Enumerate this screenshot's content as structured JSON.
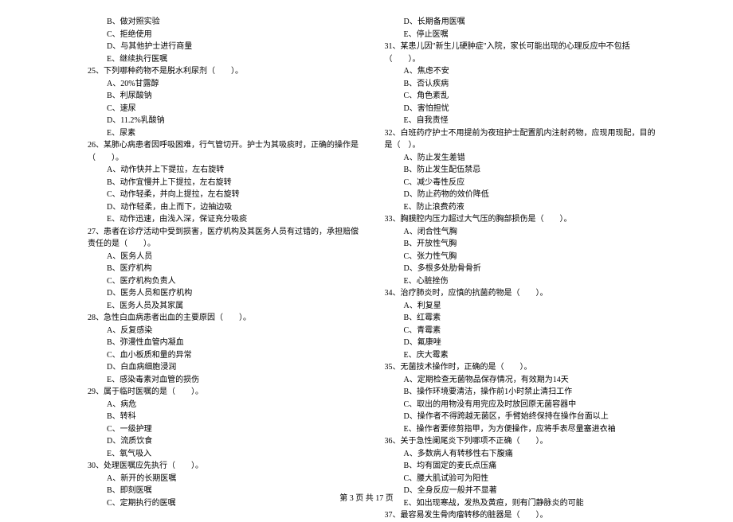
{
  "leftColumn": [
    {
      "cls": "option",
      "text": "B、做对照实验"
    },
    {
      "cls": "option",
      "text": "C、拒绝使用"
    },
    {
      "cls": "option",
      "text": "D、与其他护士进行商量"
    },
    {
      "cls": "option",
      "text": "E、继续执行医嘱"
    },
    {
      "cls": "question",
      "text": "25、下列哪种药物不是脱水利尿剂（　　）。"
    },
    {
      "cls": "option",
      "text": "A、20%甘露醇"
    },
    {
      "cls": "option",
      "text": "B、利尿酸钠"
    },
    {
      "cls": "option",
      "text": "C、速尿"
    },
    {
      "cls": "option",
      "text": "D、11.2%乳酸钠"
    },
    {
      "cls": "option",
      "text": "E、尿素"
    },
    {
      "cls": "question",
      "text": "26、某肺心病患者因呼吸困难，行气管切开。护士为其吸痰时，正确的操作是（　　）。"
    },
    {
      "cls": "option",
      "text": "A、动作快并上下提拉，左右旋转"
    },
    {
      "cls": "option",
      "text": "B、动作宜慢并上下提拉，左右旋转"
    },
    {
      "cls": "option",
      "text": "C、动作轻柔，并向上提拉，左右旋转"
    },
    {
      "cls": "option",
      "text": "D、动作轻柔，由上而下，边抽边吸"
    },
    {
      "cls": "option",
      "text": "E、动作迅速，由浅入深，保证充分吸痰"
    },
    {
      "cls": "question",
      "text": "27、患者在诊疗活动中受到损害，医疗机构及其医务人员有过错的，承担赔偿责任的是（　　）。"
    },
    {
      "cls": "option",
      "text": "A、医务人员"
    },
    {
      "cls": "option",
      "text": "B、医疗机构"
    },
    {
      "cls": "option",
      "text": "C、医疗机构负责人"
    },
    {
      "cls": "option",
      "text": "D、医务人员和医疗机构"
    },
    {
      "cls": "option",
      "text": "E、医务人员及其家属"
    },
    {
      "cls": "question",
      "text": "28、急性白血病患者出血的主要原因（　　）。"
    },
    {
      "cls": "option",
      "text": "A、反复感染"
    },
    {
      "cls": "option",
      "text": "B、弥漫性血管内凝血"
    },
    {
      "cls": "option",
      "text": "C、血小板质和量的异常"
    },
    {
      "cls": "option",
      "text": "D、白血病细胞浸润"
    },
    {
      "cls": "option",
      "text": "E、感染毒素对血管的损伤"
    },
    {
      "cls": "question",
      "text": "29、属于临时医嘱的是（　　）。"
    },
    {
      "cls": "option",
      "text": "A、病危"
    },
    {
      "cls": "option",
      "text": "B、转科"
    },
    {
      "cls": "option",
      "text": "C、一级护理"
    },
    {
      "cls": "option",
      "text": "D、流质饮食"
    },
    {
      "cls": "option",
      "text": "E、氧气吸入"
    },
    {
      "cls": "question",
      "text": "30、处理医嘱应先执行（　　）。"
    },
    {
      "cls": "option",
      "text": "A、新开的长期医嘱"
    },
    {
      "cls": "option",
      "text": "B、即刻医嘱"
    },
    {
      "cls": "option",
      "text": "C、定期执行的医嘱"
    }
  ],
  "rightColumn": [
    {
      "cls": "option",
      "text": "D、长期备用医嘱"
    },
    {
      "cls": "option",
      "text": "E、停止医嘱"
    },
    {
      "cls": "question",
      "text": "31、某患儿因\"新生儿硬肿症\"入院，家长可能出现的心理反应中不包括（　　）。"
    },
    {
      "cls": "option",
      "text": "A、焦虑不安"
    },
    {
      "cls": "option",
      "text": "B、否认疾病"
    },
    {
      "cls": "option",
      "text": "C、角色紊乱"
    },
    {
      "cls": "option",
      "text": "D、害怕担忧"
    },
    {
      "cls": "option",
      "text": "E、自我责怪"
    },
    {
      "cls": "question",
      "text": "32、白班药疗护士不用提前为夜班护士配置肌内注射药物，应现用现配，目的是（　）。"
    },
    {
      "cls": "option",
      "text": "A、防止发生差错"
    },
    {
      "cls": "option",
      "text": "B、防止发生配伍禁忌"
    },
    {
      "cls": "option",
      "text": "C、减少毒性反应"
    },
    {
      "cls": "option",
      "text": "D、防止药物的效价降低"
    },
    {
      "cls": "option",
      "text": "E、防止浪费药液"
    },
    {
      "cls": "question",
      "text": "33、胸膜腔内压力超过大气压的胸部损伤是（　　）。"
    },
    {
      "cls": "option",
      "text": "A、闭合性气胸"
    },
    {
      "cls": "option",
      "text": "B、开放性气胸"
    },
    {
      "cls": "option",
      "text": "C、张力性气胸"
    },
    {
      "cls": "option",
      "text": "D、多根多处肋骨骨折"
    },
    {
      "cls": "option",
      "text": "E、心脏挫伤"
    },
    {
      "cls": "question",
      "text": "34、治疗肺炎时，应慎的抗菌药物是（　　）。"
    },
    {
      "cls": "option",
      "text": "A、利复星"
    },
    {
      "cls": "option",
      "text": "B、红霉素"
    },
    {
      "cls": "option",
      "text": "C、青霉素"
    },
    {
      "cls": "option",
      "text": "D、氟康唑"
    },
    {
      "cls": "option",
      "text": "E、庆大霉素"
    },
    {
      "cls": "question",
      "text": "35、无菌技术操作时，正确的是（　　）。"
    },
    {
      "cls": "option",
      "text": "A、定期检查无菌物品保存情况，有效期为14天"
    },
    {
      "cls": "option",
      "text": "B、操作环境要清洁，操作前1小时禁止清扫工作"
    },
    {
      "cls": "option",
      "text": "C、取出的用物没有用完应及时放回原无菌容器中"
    },
    {
      "cls": "option",
      "text": "D、操作者不得跨越无菌区，手臂始终保持在操作台面以上"
    },
    {
      "cls": "option",
      "text": "E、操作者要修剪指甲，为方便操作，应将手表尽量塞进衣袖"
    },
    {
      "cls": "question",
      "text": "36、关于急性阑尾炎下列哪项不正确（　　）。"
    },
    {
      "cls": "option",
      "text": "A、多数病人有转移性右下腹痛"
    },
    {
      "cls": "option",
      "text": "B、均有固定的麦氏点压痛"
    },
    {
      "cls": "option",
      "text": "C、腰大肌试验可为阳性"
    },
    {
      "cls": "option",
      "text": "D、全身反应一般并不显著"
    },
    {
      "cls": "option",
      "text": "E、如出现寒战，发热及黄疸，则有门静脉炎的可能"
    },
    {
      "cls": "question",
      "text": "37、最容易发生骨肉瘤转移的脏器是（　　）。"
    }
  ],
  "footer": "第 3 页 共 17 页"
}
